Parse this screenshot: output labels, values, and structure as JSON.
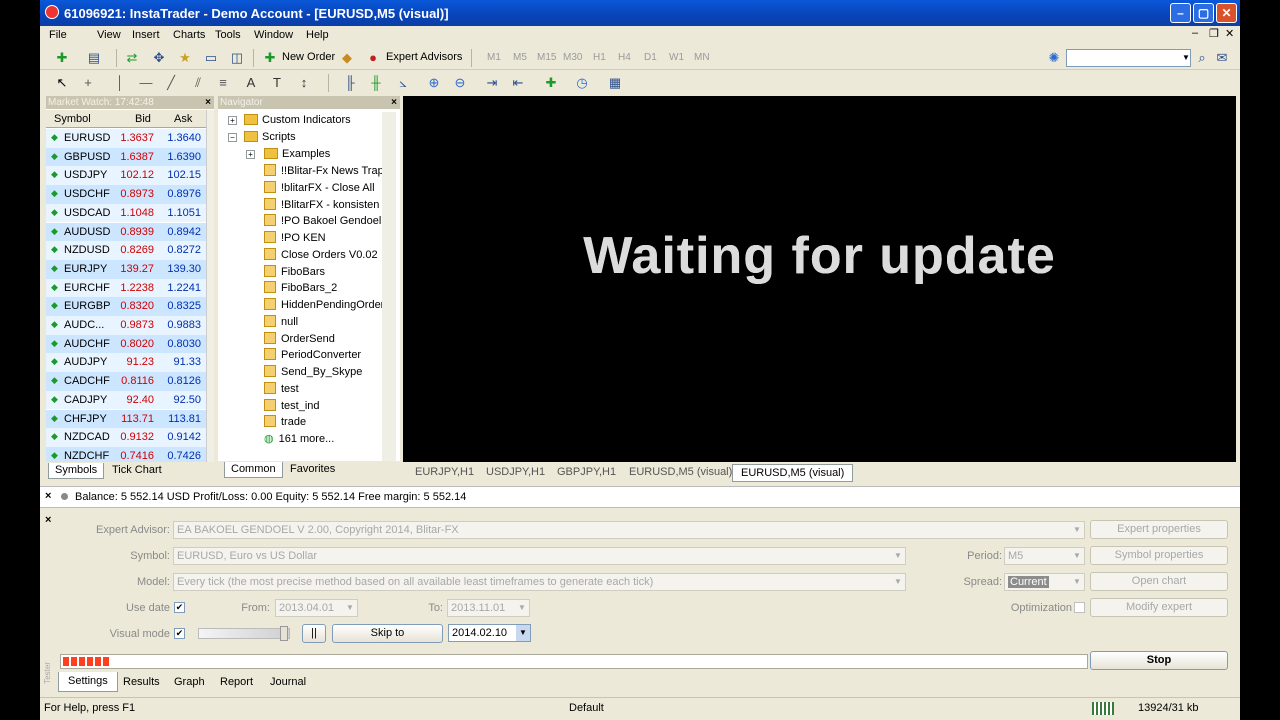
{
  "window": {
    "title": "61096921: InstaTrader - Demo Account - [EURUSD,M5 (visual)]",
    "min": "–",
    "max": "▢",
    "close": "✕",
    "child_min": "–",
    "child_max": "❐",
    "child_close": "✕"
  },
  "menu": [
    "File",
    "View",
    "Insert",
    "Charts",
    "Tools",
    "Window",
    "Help"
  ],
  "toolbar": {
    "new_order": "New Order",
    "expert_advisors": "Expert Advisors",
    "timeframes": [
      "M1",
      "M5",
      "M15",
      "M30",
      "H1",
      "H4",
      "D1",
      "W1",
      "MN"
    ]
  },
  "market_watch": {
    "header": "Market Watch: 17:42:48",
    "close": "×",
    "col_symbol": "Symbol",
    "col_bid": "Bid",
    "col_ask": "Ask",
    "rows": [
      {
        "symbol": "EURUSD",
        "bid": "1.3637",
        "ask": "1.3640"
      },
      {
        "symbol": "GBPUSD",
        "bid": "1.6387",
        "ask": "1.6390"
      },
      {
        "symbol": "USDJPY",
        "bid": "102.12",
        "ask": "102.15"
      },
      {
        "symbol": "USDCHF",
        "bid": "0.8973",
        "ask": "0.8976"
      },
      {
        "symbol": "USDCAD",
        "bid": "1.1048",
        "ask": "1.1051"
      },
      {
        "symbol": "AUDUSD",
        "bid": "0.8939",
        "ask": "0.8942"
      },
      {
        "symbol": "NZDUSD",
        "bid": "0.8269",
        "ask": "0.8272"
      },
      {
        "symbol": "EURJPY",
        "bid": "139.27",
        "ask": "139.30"
      },
      {
        "symbol": "EURCHF",
        "bid": "1.2238",
        "ask": "1.2241"
      },
      {
        "symbol": "EURGBP",
        "bid": "0.8320",
        "ask": "0.8325"
      },
      {
        "symbol": "AUDC...",
        "bid": "0.9873",
        "ask": "0.9883"
      },
      {
        "symbol": "AUDCHF",
        "bid": "0.8020",
        "ask": "0.8030"
      },
      {
        "symbol": "AUDJPY",
        "bid": "91.23",
        "ask": "91.33"
      },
      {
        "symbol": "CADCHF",
        "bid": "0.8116",
        "ask": "0.8126"
      },
      {
        "symbol": "CADJPY",
        "bid": "92.40",
        "ask": "92.50"
      },
      {
        "symbol": "CHFJPY",
        "bid": "113.71",
        "ask": "113.81"
      },
      {
        "symbol": "NZDCAD",
        "bid": "0.9132",
        "ask": "0.9142"
      },
      {
        "symbol": "NZDCHF",
        "bid": "0.7416",
        "ask": "0.7426"
      }
    ],
    "tabs": [
      "Symbols",
      "Tick Chart"
    ]
  },
  "navigator": {
    "header": "Navigator",
    "close": "×",
    "custom_indicators": "Custom Indicators",
    "scripts": "Scripts",
    "examples": "Examples",
    "items": [
      "!!Blitar-Fx News Trap",
      "!blitarFX - Close All",
      "!BlitarFX - konsisten",
      "!PO Bakoel Gendoel",
      "!PO KEN",
      "Close Orders V0.02",
      "FiboBars",
      "FiboBars_2",
      "HiddenPendingOrder",
      "null",
      "OrderSend",
      "PeriodConverter",
      "Send_By_Skype",
      "test",
      "test_ind",
      "trade"
    ],
    "more": "161 more...",
    "tabs": [
      "Common",
      "Favorites"
    ]
  },
  "chart": {
    "message": "Waiting for update",
    "tabs": [
      "EURJPY,H1",
      "USDJPY,H1",
      "GBPJPY,H1",
      "EURUSD,M5 (visual)",
      "EURUSD,M5 (visual)"
    ]
  },
  "terminal": {
    "close": "×",
    "balance": "Balance: 5 552.14 USD  Profit/Loss: 0.00  Equity: 5 552.14  Free margin: 5 552.14"
  },
  "tester": {
    "close": "×",
    "expert_label": "Expert Advisor:",
    "expert_value": "EA BAKOEL GENDOEL V 2.00, Copyright 2014, Blitar-FX",
    "symbol_label": "Symbol:",
    "symbol_value": "EURUSD, Euro vs US Dollar",
    "model_label": "Model:",
    "model_value": "Every tick (the most precise method based on all available least timeframes to generate each tick)",
    "use_date_label": "Use date",
    "from_label": "From:",
    "from_value": "2013.04.01",
    "to_label": "To:",
    "to_value": "2013.11.01",
    "visual_label": "Visual mode",
    "pause": "||",
    "skip_to": "Skip to",
    "skip_date": "2014.02.10",
    "period_label": "Period:",
    "period_value": "M5",
    "spread_label": "Spread:",
    "spread_value": "Current",
    "optimization_label": "Optimization",
    "btn_expert_props": "Expert properties",
    "btn_symbol_props": "Symbol properties",
    "btn_open_chart": "Open chart",
    "btn_modify_expert": "Modify expert",
    "btn_stop": "Stop",
    "progress": 0.08,
    "tabs": [
      "Settings",
      "Results",
      "Graph",
      "Report",
      "Journal"
    ],
    "side_label": "Tester"
  },
  "statusbar": {
    "help": "For Help, press F1",
    "profile": "Default",
    "traffic": "13924/31 kb"
  }
}
